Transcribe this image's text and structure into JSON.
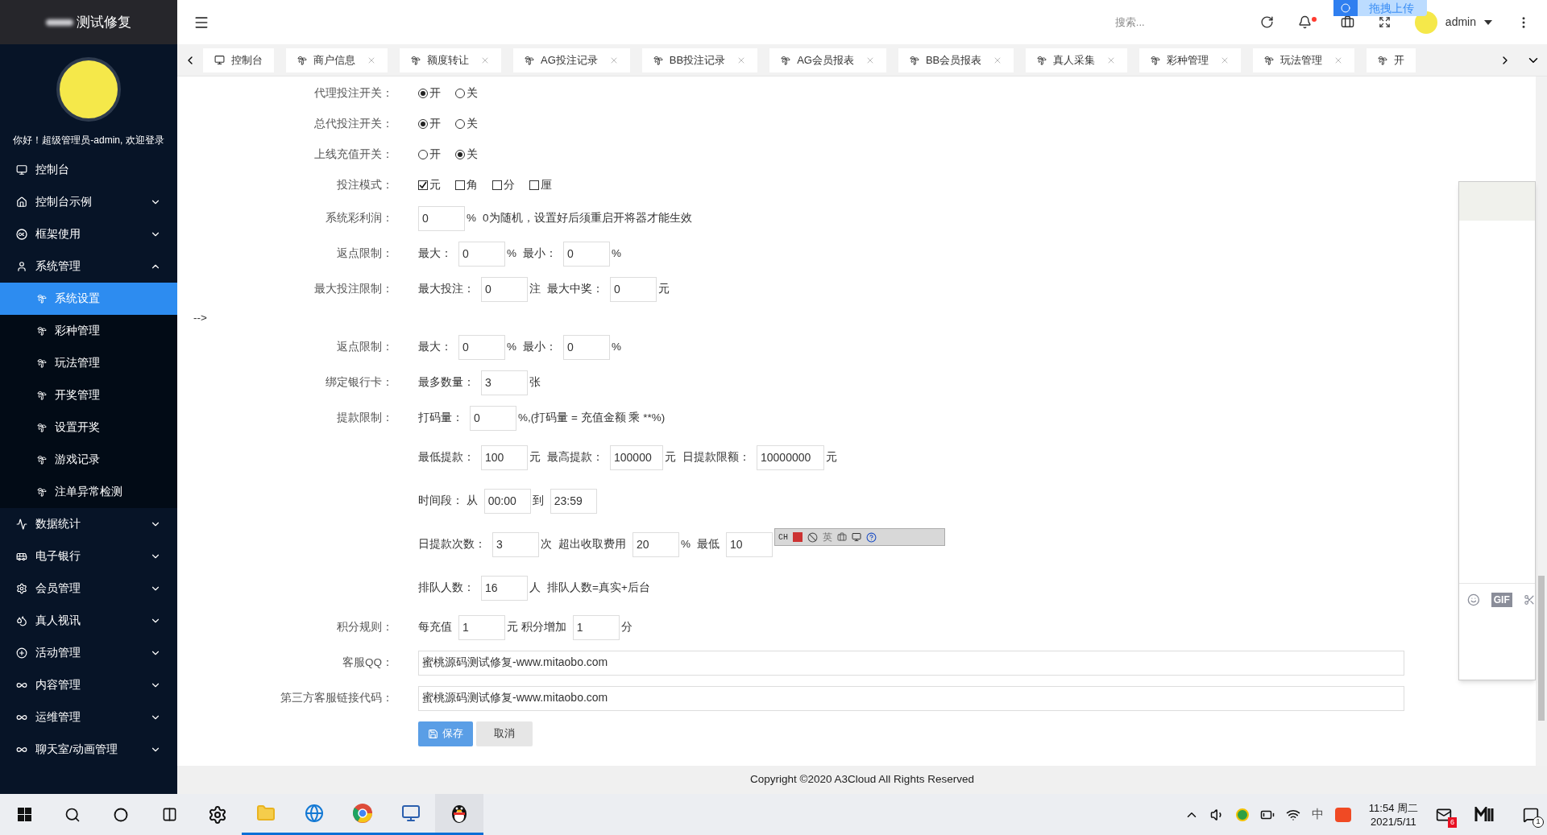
{
  "sidebar": {
    "brand": "测试修复",
    "greeting": "你好！超级管理员-admin, 欢迎登录",
    "items": [
      {
        "label": "控制台",
        "kind": "link"
      },
      {
        "label": "控制台示例",
        "kind": "group",
        "expanded": false
      },
      {
        "label": "框架使用",
        "kind": "group",
        "expanded": false
      },
      {
        "label": "系统管理",
        "kind": "group",
        "expanded": true,
        "children": [
          {
            "label": "系统设置",
            "selected": true
          },
          {
            "label": "彩种管理",
            "selected": false
          },
          {
            "label": "玩法管理",
            "selected": false
          },
          {
            "label": "开奖管理",
            "selected": false
          },
          {
            "label": "设置开奖",
            "selected": false
          },
          {
            "label": "游戏记录",
            "selected": false
          },
          {
            "label": "注单异常检测",
            "selected": false
          }
        ]
      },
      {
        "label": "数据统计",
        "kind": "group",
        "expanded": false
      },
      {
        "label": "电子银行",
        "kind": "group",
        "expanded": false
      },
      {
        "label": "会员管理",
        "kind": "group",
        "expanded": false
      },
      {
        "label": "真人视讯",
        "kind": "group",
        "expanded": false
      },
      {
        "label": "活动管理",
        "kind": "group",
        "expanded": false
      },
      {
        "label": "内容管理",
        "kind": "group",
        "expanded": false
      },
      {
        "label": "运维管理",
        "kind": "group",
        "expanded": false
      },
      {
        "label": "聊天室/动画管理",
        "kind": "group",
        "expanded": false
      }
    ]
  },
  "header": {
    "search": {
      "placeholder": "搜索..."
    },
    "notification_dot": true,
    "user": "admin",
    "upload_badge": "拖拽上传"
  },
  "tabs": [
    {
      "label": "控制台",
      "closable": false
    },
    {
      "label": "商户信息",
      "closable": true
    },
    {
      "label": "额度转让",
      "closable": true
    },
    {
      "label": "AG投注记录",
      "closable": true
    },
    {
      "label": "BB投注记录",
      "closable": true
    },
    {
      "label": "AG会员报表",
      "closable": true
    },
    {
      "label": "BB会员报表",
      "closable": true
    },
    {
      "label": "真人采集",
      "closable": true
    },
    {
      "label": "彩种管理",
      "closable": true
    },
    {
      "label": "玩法管理",
      "closable": true
    },
    {
      "label": "开",
      "closable": false
    }
  ],
  "form": [
    {
      "kind": "toggle",
      "label": "代理投注开关：",
      "parts": [
        {
          "kind": "radio",
          "label": "开",
          "selected": true
        },
        {
          "kind": "radio",
          "label": "关",
          "selected": false
        }
      ]
    },
    {
      "kind": "toggle",
      "label": "总代投注开关：",
      "parts": [
        {
          "kind": "radio",
          "label": "开",
          "selected": true
        },
        {
          "kind": "radio",
          "label": "关",
          "selected": false
        }
      ]
    },
    {
      "kind": "toggle",
      "label": "上线充值开关：",
      "parts": [
        {
          "kind": "radio",
          "label": "开",
          "selected": false
        },
        {
          "kind": "radio",
          "label": "关",
          "selected": true
        }
      ]
    },
    {
      "kind": "toggle",
      "label": "投注模式：",
      "parts": [
        {
          "kind": "checkbox",
          "label": "元",
          "checked": true
        },
        {
          "kind": "checkbox",
          "label": "角",
          "checked": false
        },
        {
          "kind": "checkbox",
          "label": "分",
          "checked": false
        },
        {
          "kind": "checkbox",
          "label": "厘",
          "checked": false
        }
      ]
    },
    {
      "kind": "field",
      "label": "系统彩利润：",
      "parts": [
        {
          "kind": "input",
          "value": "0"
        },
        {
          "kind": "text",
          "text": "%"
        },
        {
          "kind": "text",
          "text": "0为随机，设置好后须重启开将器才能生效"
        }
      ]
    },
    {
      "kind": "field",
      "label": "返点限制：",
      "parts": [
        {
          "kind": "text",
          "text": "最大："
        },
        {
          "kind": "input",
          "value": "0"
        },
        {
          "kind": "text",
          "text": "%"
        },
        {
          "kind": "text",
          "text": "最小："
        },
        {
          "kind": "input",
          "value": "0"
        },
        {
          "kind": "text",
          "text": "%"
        }
      ]
    },
    {
      "kind": "field",
      "label": "最大投注限制：",
      "parts": [
        {
          "kind": "text",
          "text": "最大投注："
        },
        {
          "kind": "input",
          "value": "0"
        },
        {
          "kind": "text",
          "text": "注"
        },
        {
          "kind": "text",
          "text": "最大中奖："
        },
        {
          "kind": "input",
          "value": "0"
        },
        {
          "kind": "text",
          "text": "元"
        }
      ]
    },
    {
      "kind": "comment",
      "parts": [
        {
          "kind": "text",
          "text": "-->"
        }
      ]
    },
    {
      "kind": "field",
      "label": "返点限制：",
      "parts": [
        {
          "kind": "text",
          "text": "最大："
        },
        {
          "kind": "input",
          "value": "0"
        },
        {
          "kind": "text",
          "text": "%"
        },
        {
          "kind": "text",
          "text": "最小："
        },
        {
          "kind": "input",
          "value": "0"
        },
        {
          "kind": "text",
          "text": "%"
        }
      ]
    },
    {
      "kind": "field",
      "label": "绑定银行卡：",
      "parts": [
        {
          "kind": "text",
          "text": "最多数量："
        },
        {
          "kind": "input",
          "value": "3"
        },
        {
          "kind": "text",
          "text": "张"
        }
      ]
    },
    {
      "kind": "field",
      "label": "提款限制：",
      "parts": [
        {
          "kind": "text",
          "text": "打码量："
        },
        {
          "kind": "input",
          "value": "0"
        },
        {
          "kind": "text",
          "text": "%,(打码量 = 充值金额 乘 **%)"
        }
      ]
    },
    {
      "kind": "sub",
      "parts": [
        {
          "kind": "text",
          "text": "最低提款："
        },
        {
          "kind": "input",
          "value": "100"
        },
        {
          "kind": "text",
          "text": "元"
        },
        {
          "kind": "text",
          "text": "最高提款："
        },
        {
          "kind": "input",
          "value": "100000"
        },
        {
          "kind": "text",
          "text": "元"
        },
        {
          "kind": "text",
          "text": "日提款限额："
        },
        {
          "kind": "input",
          "value": "10000000"
        },
        {
          "kind": "text",
          "text": "元"
        }
      ]
    },
    {
      "kind": "sub",
      "parts": [
        {
          "kind": "text",
          "text": "时间段： 从"
        },
        {
          "kind": "input",
          "value": "00:00"
        },
        {
          "kind": "text",
          "text": "到"
        },
        {
          "kind": "input",
          "value": "23:59"
        }
      ]
    },
    {
      "kind": "sub",
      "parts": [
        {
          "kind": "text",
          "text": "日提款次数："
        },
        {
          "kind": "input",
          "value": "3"
        },
        {
          "kind": "text",
          "text": "次"
        },
        {
          "kind": "text",
          "text": "超出收取费用"
        },
        {
          "kind": "input",
          "value": "20"
        },
        {
          "kind": "text",
          "text": "%"
        },
        {
          "kind": "text",
          "text": "最低"
        },
        {
          "kind": "input",
          "value": "10"
        },
        {
          "kind": "ime_toolbar",
          "labels": [
            "CH",
            "英"
          ]
        }
      ]
    },
    {
      "kind": "sub",
      "parts": [
        {
          "kind": "text",
          "text": "排队人数："
        },
        {
          "kind": "input",
          "value": "16"
        },
        {
          "kind": "text",
          "text": "人"
        },
        {
          "kind": "text",
          "text": "排队人数=真实+后台"
        }
      ]
    },
    {
      "kind": "field",
      "label": "积分规则：",
      "parts": [
        {
          "kind": "text",
          "text": "每充值"
        },
        {
          "kind": "input",
          "value": "1"
        },
        {
          "kind": "text",
          "text": "元 积分增加"
        },
        {
          "kind": "input",
          "value": "1"
        },
        {
          "kind": "text",
          "text": "分"
        }
      ]
    },
    {
      "kind": "field",
      "label": "客服QQ：",
      "parts": [
        {
          "kind": "wide_input",
          "value": "蜜桃源码测试修复-www.mitaobo.com"
        }
      ]
    },
    {
      "kind": "field",
      "label": "第三方客服链接代码：",
      "parts": [
        {
          "kind": "wide_input",
          "value": "蜜桃源码测试修复-www.mitaobo.com"
        }
      ]
    },
    {
      "kind": "actions",
      "parts": [
        {
          "kind": "button",
          "label": "保存"
        },
        {
          "kind": "button",
          "label": "取消"
        }
      ]
    }
  ],
  "chat_panel": {
    "gif": "GIF"
  },
  "footer": "Copyright ©2020 A3Cloud All Rights Reserved",
  "taskbar": {
    "ime": "中",
    "time": "11:54 周二",
    "date": "2021/5/11",
    "mail_badge": "6",
    "notification_badge": "1"
  }
}
